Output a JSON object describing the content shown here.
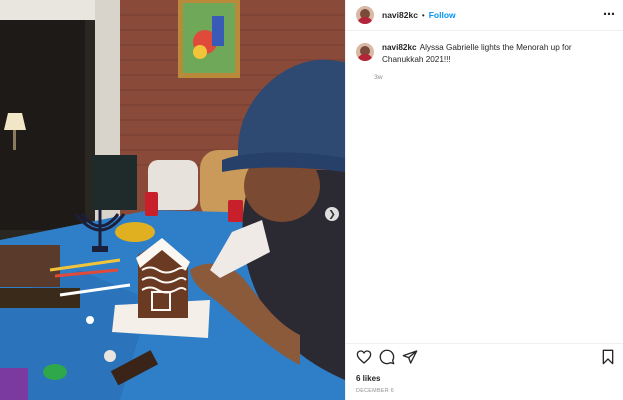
{
  "post": {
    "author": "navi82kc",
    "separator": "•",
    "follow_label": "Follow",
    "more_icon": "more-horizontal-icon",
    "caption": {
      "username": "navi82kc",
      "text": "Alyssa Gabrielle lights the Menorah up for Chanukkah 2021!!!",
      "time_ago": "3w"
    },
    "actions": {
      "like_icon": "heart-icon",
      "comment_icon": "comment-icon",
      "share_icon": "share-icon",
      "save_icon": "bookmark-icon"
    },
    "likes": "6 likes",
    "date": "DECEMBER 6",
    "next_icon": "chevron-right-icon"
  },
  "colors": {
    "link": "#0095f6",
    "text": "#262626",
    "muted": "#8e8e8e",
    "border": "#efefef",
    "tablecloth": "#2f7ec8"
  }
}
